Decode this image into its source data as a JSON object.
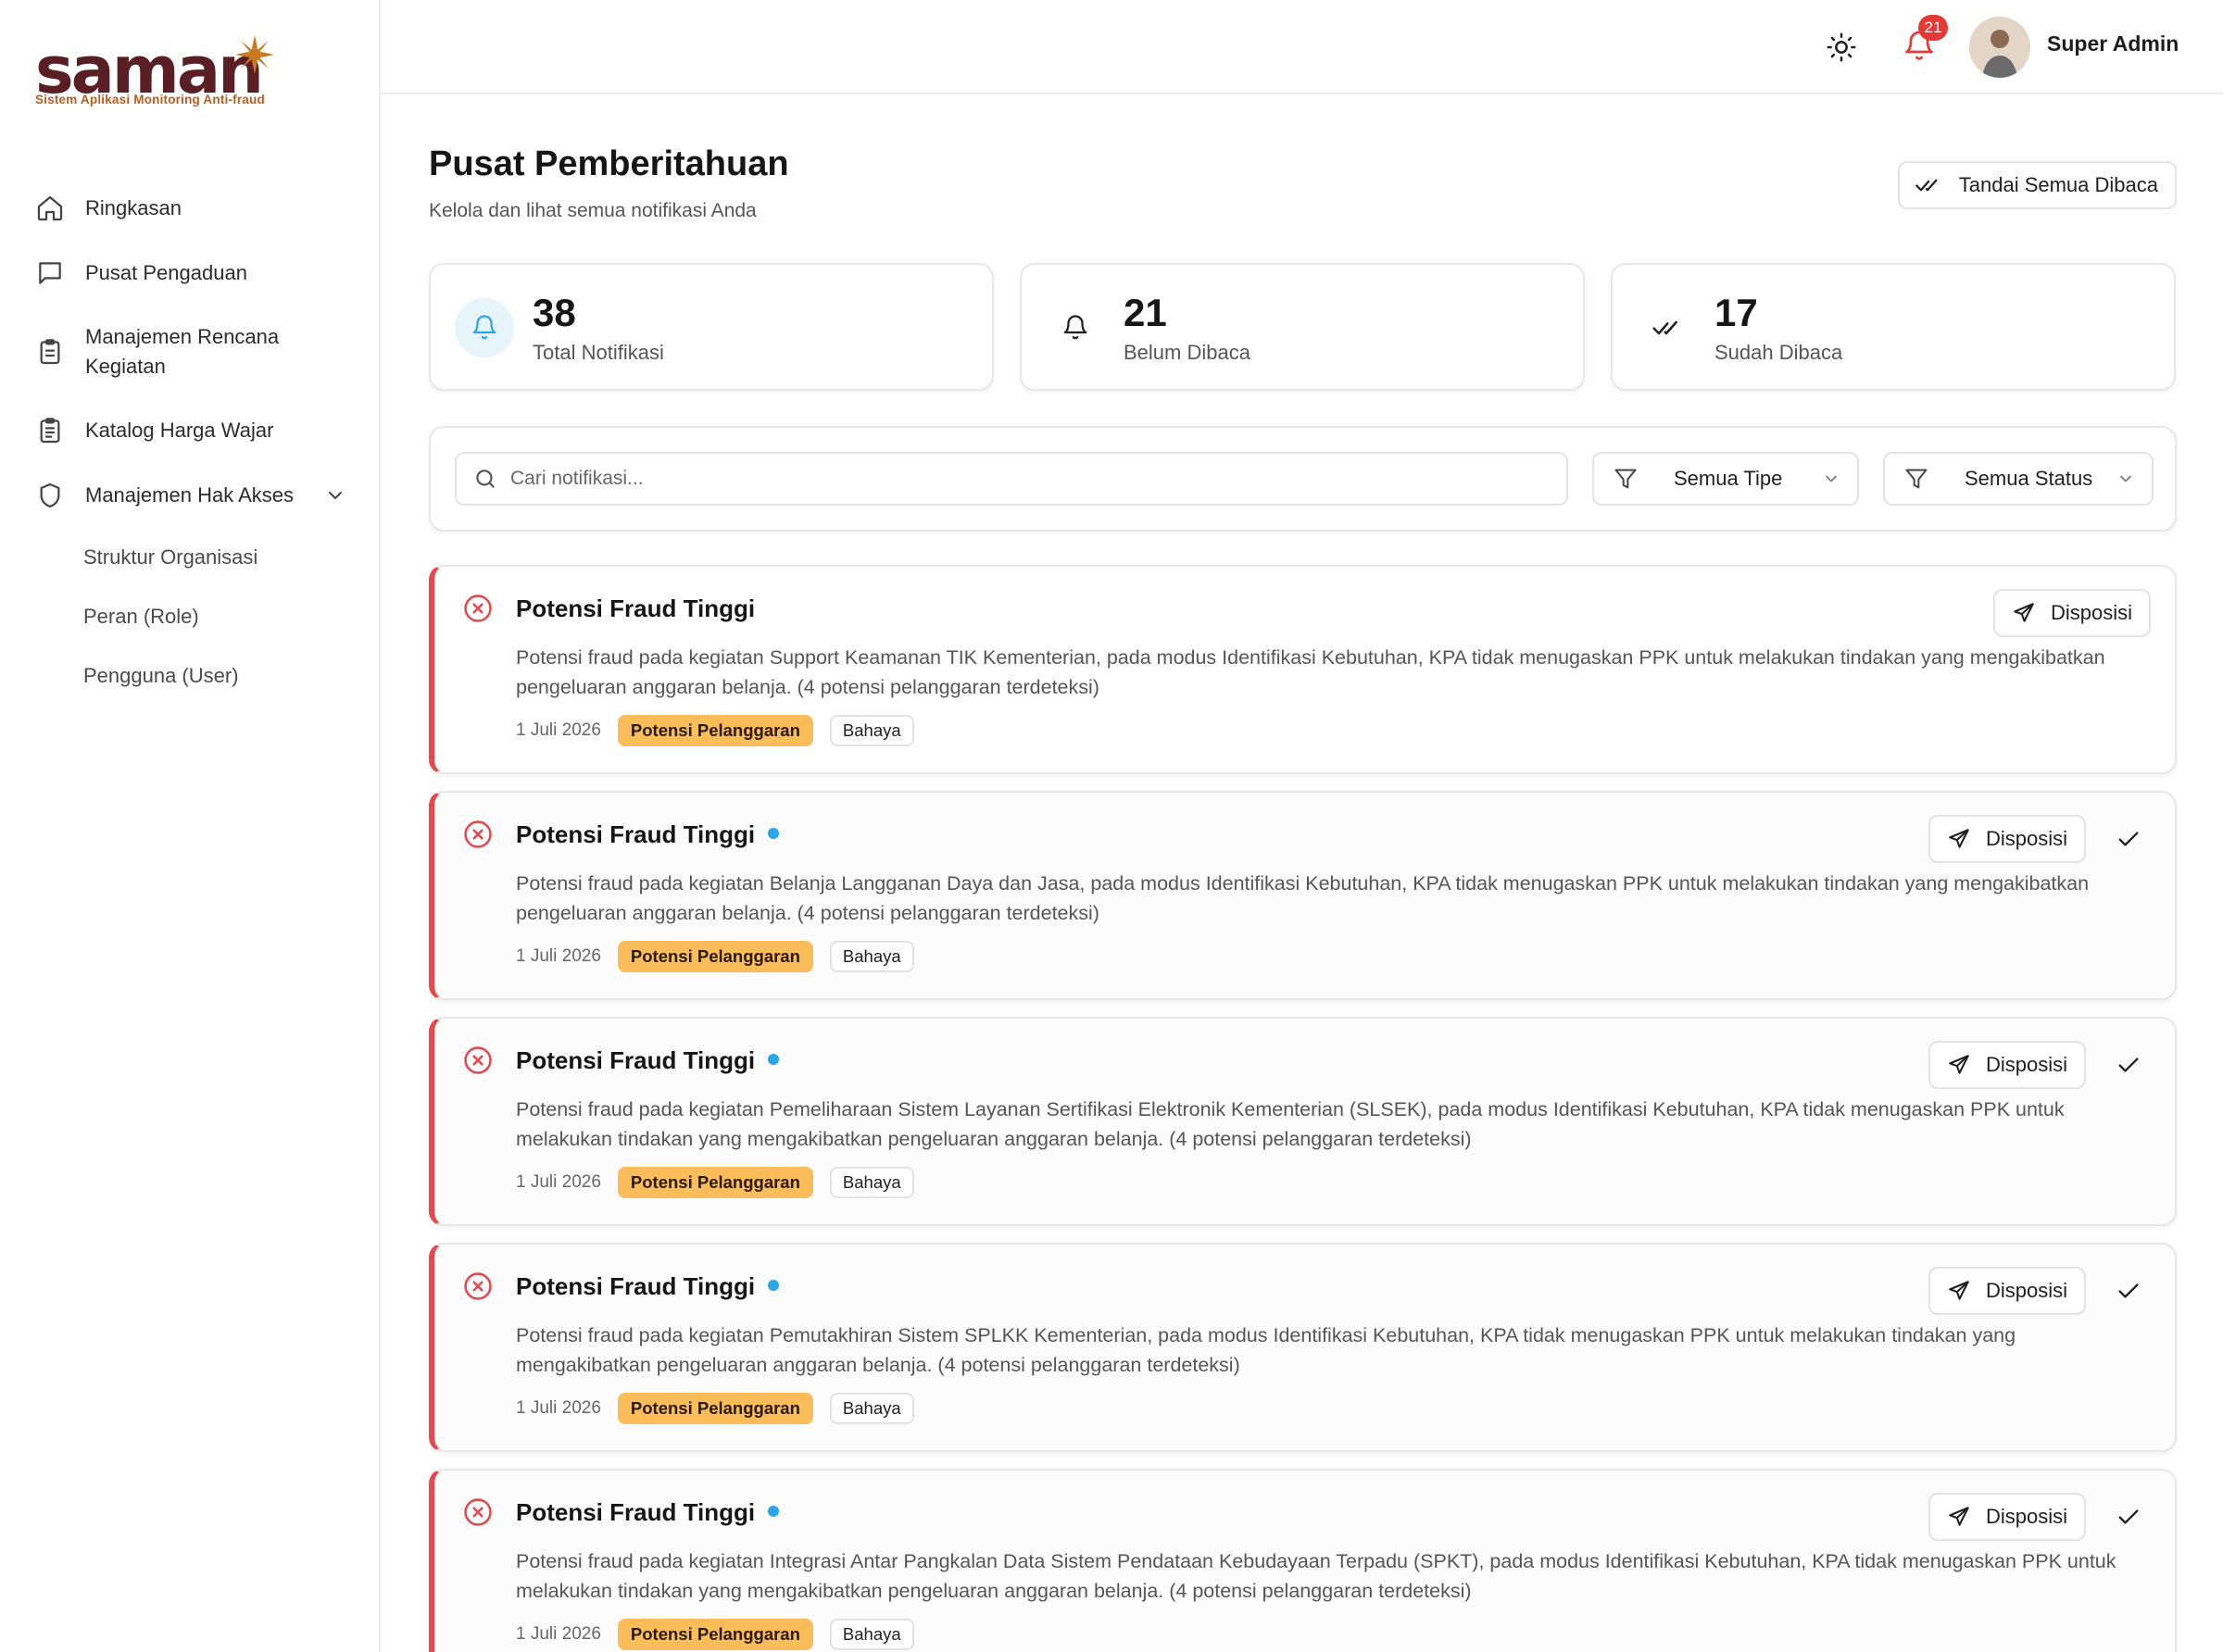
{
  "app": {
    "logo_text": "saman",
    "logo_tagline": "Sistem Aplikasi Monitoring Anti-fraud"
  },
  "sidebar": {
    "items": [
      {
        "label": "Ringkasan",
        "icon": "home-icon"
      },
      {
        "label": "Pusat Pengaduan",
        "icon": "chat-icon"
      },
      {
        "label": "Manajemen Rencana Kegiatan",
        "icon": "clipboard-icon"
      },
      {
        "label": "Katalog Harga Wajar",
        "icon": "clipboard-list-icon"
      },
      {
        "label": "Manajemen Hak Akses",
        "icon": "shield-icon"
      }
    ],
    "subitems": [
      {
        "label": "Struktur Organisasi"
      },
      {
        "label": "Peran (Role)"
      },
      {
        "label": "Pengguna (User)"
      }
    ]
  },
  "topbar": {
    "notification_count": "21",
    "user_name": "Super Admin"
  },
  "header": {
    "title": "Pusat Pemberitahuan",
    "subtitle": "Kelola dan lihat semua notifikasi Anda",
    "mark_all_label": "Tandai Semua Dibaca"
  },
  "stats": [
    {
      "value": "38",
      "label": "Total Notifikasi",
      "icon": "bell-icon"
    },
    {
      "value": "21",
      "label": "Belum Dibaca",
      "icon": "bell-icon"
    },
    {
      "value": "17",
      "label": "Sudah Dibaca",
      "icon": "double-check-icon"
    }
  ],
  "filters": {
    "search_placeholder": "Cari notifikasi...",
    "type_select": "Semua Tipe",
    "status_select": "Semua Status"
  },
  "notifications": [
    {
      "title": "Potensi Fraud Tinggi",
      "unread": false,
      "description": "Potensi fraud pada kegiatan Support Keamanan TIK Kementerian, pada modus Identifikasi Kebutuhan, KPA tidak menugaskan PPK untuk melakukan tindakan yang mengakibatkan pengeluaran anggaran belanja. (4 potensi pelanggaran terdeteksi)",
      "date": "1 Juli 2026",
      "category": "Potensi Pelanggaran",
      "severity": "Bahaya",
      "action": "Disposisi"
    },
    {
      "title": "Potensi Fraud Tinggi",
      "unread": true,
      "description": "Potensi fraud pada kegiatan Belanja Langganan Daya dan Jasa, pada modus Identifikasi Kebutuhan, KPA tidak menugaskan PPK untuk melakukan tindakan yang mengakibatkan pengeluaran anggaran belanja. (4 potensi pelanggaran terdeteksi)",
      "date": "1 Juli 2026",
      "category": "Potensi Pelanggaran",
      "severity": "Bahaya",
      "action": "Disposisi"
    },
    {
      "title": "Potensi Fraud Tinggi",
      "unread": true,
      "description": "Potensi fraud pada kegiatan Pemeliharaan Sistem Layanan Sertifikasi Elektronik Kementerian (SLSEK), pada modus Identifikasi Kebutuhan, KPA tidak menugaskan PPK untuk melakukan tindakan yang mengakibatkan pengeluaran anggaran belanja. (4 potensi pelanggaran terdeteksi)",
      "date": "1 Juli 2026",
      "category": "Potensi Pelanggaran",
      "severity": "Bahaya",
      "action": "Disposisi"
    },
    {
      "title": "Potensi Fraud Tinggi",
      "unread": true,
      "description": "Potensi fraud pada kegiatan Pemutakhiran Sistem SPLKK Kementerian, pada modus Identifikasi Kebutuhan, KPA tidak menugaskan PPK untuk melakukan tindakan yang mengakibatkan pengeluaran anggaran belanja. (4 potensi pelanggaran terdeteksi)",
      "date": "1 Juli 2026",
      "category": "Potensi Pelanggaran",
      "severity": "Bahaya",
      "action": "Disposisi"
    },
    {
      "title": "Potensi Fraud Tinggi",
      "unread": true,
      "description": "Potensi fraud pada kegiatan Integrasi Antar Pangkalan Data Sistem Pendataan Kebudayaan Terpadu (SPKT), pada modus Identifikasi Kebutuhan, KPA tidak menugaskan PPK untuk melakukan tindakan yang mengakibatkan pengeluaran anggaran belanja. (4 potensi pelanggaran terdeteksi)",
      "date": "1 Juli 2026",
      "category": "Potensi Pelanggaran",
      "severity": "Bahaya",
      "action": "Disposisi"
    }
  ],
  "colors": {
    "brand": "#5a1f25",
    "accent": "#2aa5e8",
    "danger": "#e5484d",
    "warning_tag": "#fbbd5a"
  }
}
